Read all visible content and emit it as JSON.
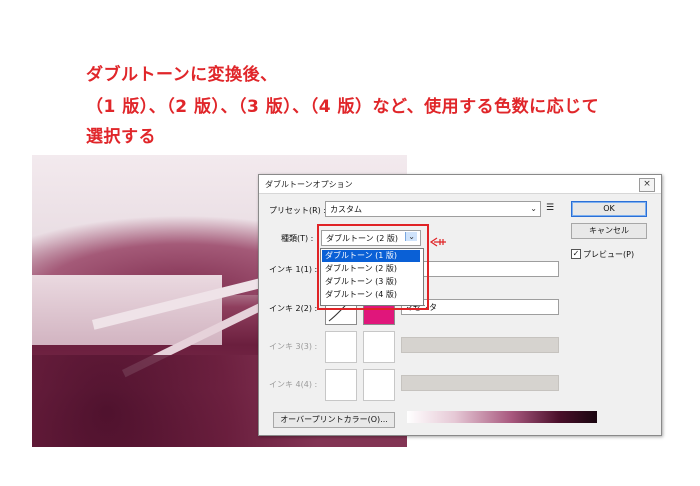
{
  "caption": {
    "line1": "ダブルトーンに変換後、",
    "line2": "（1 版）、（2 版）、（3 版）、（4 版）など、使用する色数に応じて",
    "line3": "選択する"
  },
  "dialog": {
    "title": "ダブルトーンオプション",
    "close_glyph": "×",
    "preset_label": "プリセット(R) :",
    "preset_value": "カスタム",
    "type_label": "種類(T) :",
    "type_value": "ダブルトーン (2 版)",
    "type_options": [
      "ダブルトーン (1 版)",
      "ダブルトーン (2 版)",
      "ダブルトーン (3 版)",
      "ダブルトーン (4 版)"
    ],
    "selected_option_index": 0,
    "ink1_label": "インキ 1(1) :",
    "ink1_name": "",
    "ink2_label": "インキ 2(2) :",
    "ink2_name": "マゼンタ",
    "ink2_color": "#e0167b",
    "ink3_label": "インキ 3(3) :",
    "ink4_label": "インキ 4(4) :",
    "ok_label": "OK",
    "cancel_label": "キャンセル",
    "preview_label": "プレビュー(P)",
    "preview_checked": true,
    "overprint_label": "オーバープリントカラー(O)..."
  },
  "colors": {
    "caption": "#e0262a",
    "highlight": "#e02326",
    "selection": "#0a60d6"
  }
}
